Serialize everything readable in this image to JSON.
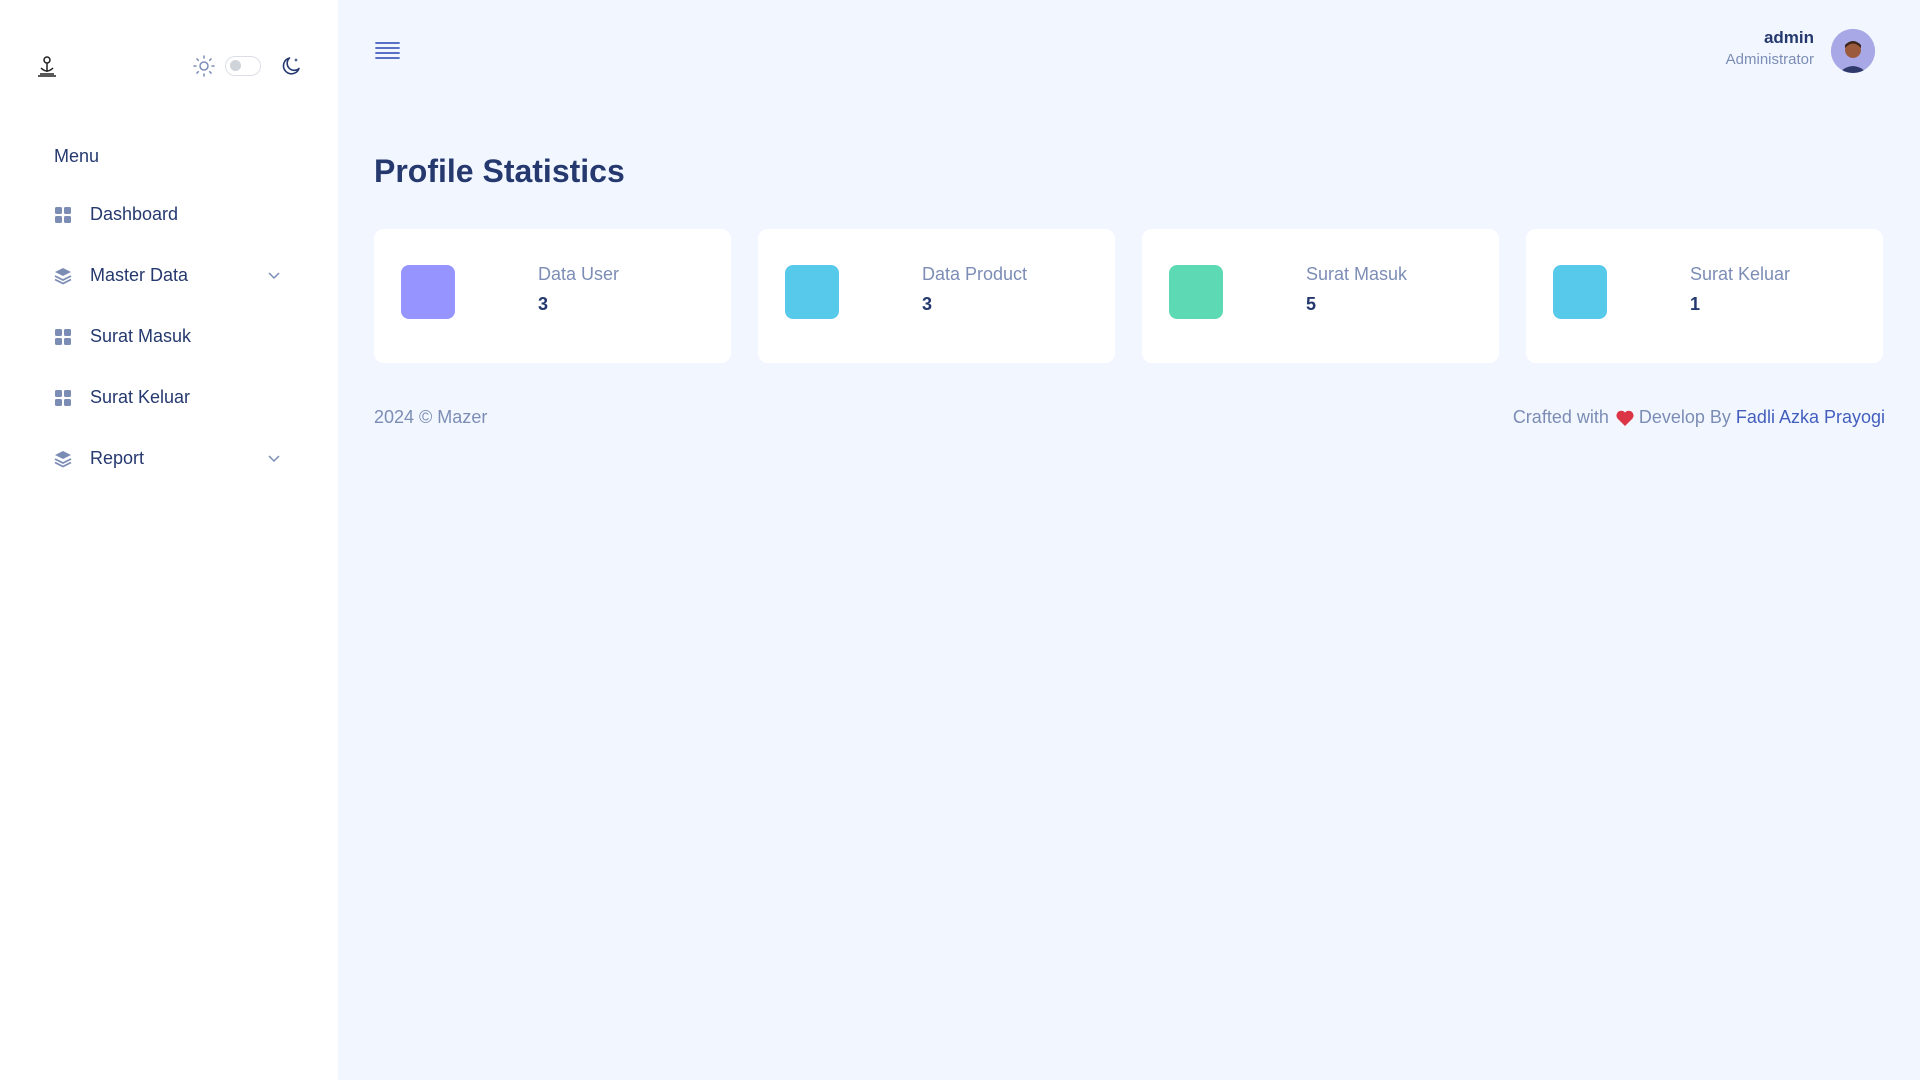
{
  "theme": {
    "background": "#f2f7ff",
    "sidebar_bg": "#ffffff",
    "text_primary": "#25396f",
    "text_muted": "#7c8db5",
    "link": "#435ebe",
    "heart": "#dc3545"
  },
  "sidebar": {
    "logo_icon": "logo-icon",
    "menu_title": "Menu",
    "items": [
      {
        "label": "Dashboard",
        "icon": "grid-icon",
        "has_submenu": false
      },
      {
        "label": "Master Data",
        "icon": "stack-icon",
        "has_submenu": true
      },
      {
        "label": "Surat Masuk",
        "icon": "grid-icon",
        "has_submenu": false
      },
      {
        "label": "Surat Keluar",
        "icon": "grid-icon",
        "has_submenu": false
      },
      {
        "label": "Report",
        "icon": "stack-icon",
        "has_submenu": true
      }
    ]
  },
  "header": {
    "user_name": "admin",
    "user_role": "Administrator"
  },
  "main": {
    "title": "Profile Statistics",
    "cards": [
      {
        "label": "Data User",
        "value": "3",
        "color": "#9694ff"
      },
      {
        "label": "Data Product",
        "value": "3",
        "color": "#57caeb"
      },
      {
        "label": "Surat Masuk",
        "value": "5",
        "color": "#5ddab4"
      },
      {
        "label": "Surat Keluar",
        "value": "1",
        "color": "#57caeb"
      }
    ]
  },
  "footer": {
    "copyright": "2024 © Mazer",
    "crafted_prefix": "Crafted with",
    "crafted_middle": "Develop By",
    "author": "Fadli Azka Prayogi"
  }
}
